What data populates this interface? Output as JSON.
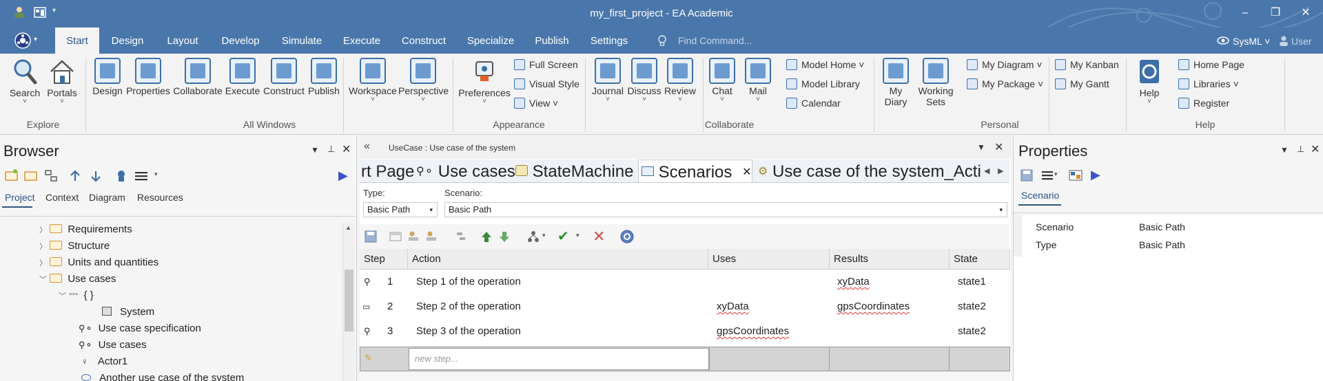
{
  "window": {
    "title": "my_first_project - EA Academic"
  },
  "menu": {
    "tabs": [
      "Start",
      "Design",
      "Layout",
      "Develop",
      "Simulate",
      "Execute",
      "Construct",
      "Specialize",
      "Publish",
      "Settings"
    ],
    "active": "Start",
    "find_placeholder": "Find Command...",
    "perspective": "SysML",
    "user": "User"
  },
  "ribbon": {
    "explore": {
      "label": "Explore",
      "search": "Search",
      "portals": "Portals"
    },
    "all_windows": {
      "label": "All Windows",
      "items": [
        "Design",
        "Properties",
        "Collaborate",
        "Execute",
        "Construct",
        "Publish",
        "Workspace",
        "Perspective"
      ]
    },
    "appearance": {
      "label": "Appearance",
      "preferences": "Preferences",
      "full_screen": "Full Screen",
      "visual_style": "Visual Style",
      "view": "View"
    },
    "collaborate": {
      "label": "Collaborate",
      "journal": "Journal",
      "discuss": "Discuss",
      "review": "Review",
      "chat": "Chat",
      "mail": "Mail",
      "model_home": "Model Home",
      "model_library": "Model Library",
      "calendar": "Calendar"
    },
    "personal": {
      "label": "Personal",
      "my_diary_1": "My",
      "my_diary_2": "Diary",
      "working_sets_1": "Working",
      "working_sets_2": "Sets",
      "my_diagram": "My Diagram",
      "my_package": "My Package",
      "my_kanban": "My Kanban",
      "my_gantt": "My Gantt"
    },
    "help": {
      "label": "Help",
      "help": "Help",
      "home_page": "Home Page",
      "libraries": "Libraries",
      "register": "Register"
    }
  },
  "browser": {
    "title": "Browser",
    "tabs": [
      "Project",
      "Context",
      "Diagram",
      "Resources"
    ],
    "tree": [
      {
        "label": "Requirements"
      },
      {
        "label": "Structure"
      },
      {
        "label": "Units and quantities"
      },
      {
        "label": "Use cases"
      },
      {
        "label": "{ }"
      },
      {
        "label": "System"
      },
      {
        "label": "Use case specification"
      },
      {
        "label": "Use cases"
      },
      {
        "label": "Actor1"
      },
      {
        "label": "Another use case of the system"
      }
    ]
  },
  "editor": {
    "breadcrumb": "UseCase : Use case of the system",
    "doc_tabs": [
      "rt Page",
      "Use cases",
      "StateMachine",
      "Scenarios",
      "Use case of the system_Acti..."
    ],
    "active_tab": "Scenarios",
    "type_label": "Type:",
    "type_value": "Basic Path",
    "scenario_label": "Scenario:",
    "scenario_value": "Basic Path",
    "columns": [
      "Step",
      "Action",
      "Uses",
      "Results",
      "State"
    ],
    "rows": [
      {
        "step": "1",
        "action": "Step 1 of the operation",
        "uses": "",
        "results": "xyData",
        "state": "state1"
      },
      {
        "step": "2",
        "action": "Step 2 of the operation",
        "uses": "xyData",
        "results": "gpsCoordinates",
        "state": "state2"
      },
      {
        "step": "3",
        "action": "Step 3 of the operation",
        "uses": "gpsCoordinates",
        "results": "",
        "state": "state2"
      }
    ],
    "new_step_placeholder": "new step..."
  },
  "properties": {
    "title": "Properties",
    "tab": "Scenario",
    "rows": [
      {
        "name": "Scenario",
        "value": "Basic Path"
      },
      {
        "name": "Type",
        "value": "Basic Path"
      }
    ]
  },
  "colors": {
    "titlebar": "#4a77ab",
    "accent": "#2a5587",
    "folder": "#d79233"
  }
}
